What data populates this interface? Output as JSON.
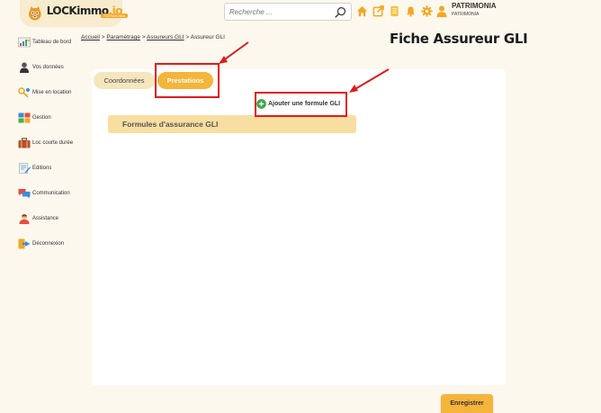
{
  "header": {
    "logo_text": "LOCKimmo",
    "logo_suffix": ".io",
    "logo_sub": "PATRIMONIA",
    "search_placeholder": "Recherche ...",
    "user_name": "PATRIMONIA",
    "user_sub": "PATRIMONIA",
    "icons": [
      "home-icon",
      "external-link-icon",
      "document-icon",
      "bell-icon",
      "gear-icon",
      "user-icon"
    ]
  },
  "sidebar": {
    "items": [
      {
        "label": "Tableau de bord",
        "icon": "dashboard-icon"
      },
      {
        "label": "Vos données",
        "icon": "person-icon"
      },
      {
        "label": "Mise en location",
        "icon": "keys-icon"
      },
      {
        "label": "Gestion",
        "icon": "gestion-icon"
      },
      {
        "label": "Loc courte durée",
        "icon": "suitcase-icon"
      },
      {
        "label": "Editions",
        "icon": "editions-icon"
      },
      {
        "label": "Communication",
        "icon": "chat-icon"
      },
      {
        "label": "Assistance",
        "icon": "assistance-icon"
      },
      {
        "label": "Déconnexion",
        "icon": "logout-icon"
      }
    ]
  },
  "breadcrumb": {
    "items": [
      "Accueil",
      "Paramétrage",
      "Assureurs GLI"
    ],
    "current": "Assureur GLI",
    "sep": ">"
  },
  "page": {
    "title": "Fiche Assureur GLI"
  },
  "tabs": [
    {
      "label": "Coordonnées",
      "active": false
    },
    {
      "label": "Prestations",
      "active": true
    }
  ],
  "content": {
    "add_button_label": "Ajouter une formule GLI",
    "section_title": "Formules d'assurance GLI"
  },
  "footer": {
    "save_label": "Enregistrer"
  },
  "colors": {
    "accent": "#f5b43a",
    "tab_inactive": "#f6e6be",
    "section_bg": "#f8dea0",
    "highlight": "#e01b1b",
    "page_bg": "#fdf8ee",
    "add_icon": "#3aa545"
  }
}
